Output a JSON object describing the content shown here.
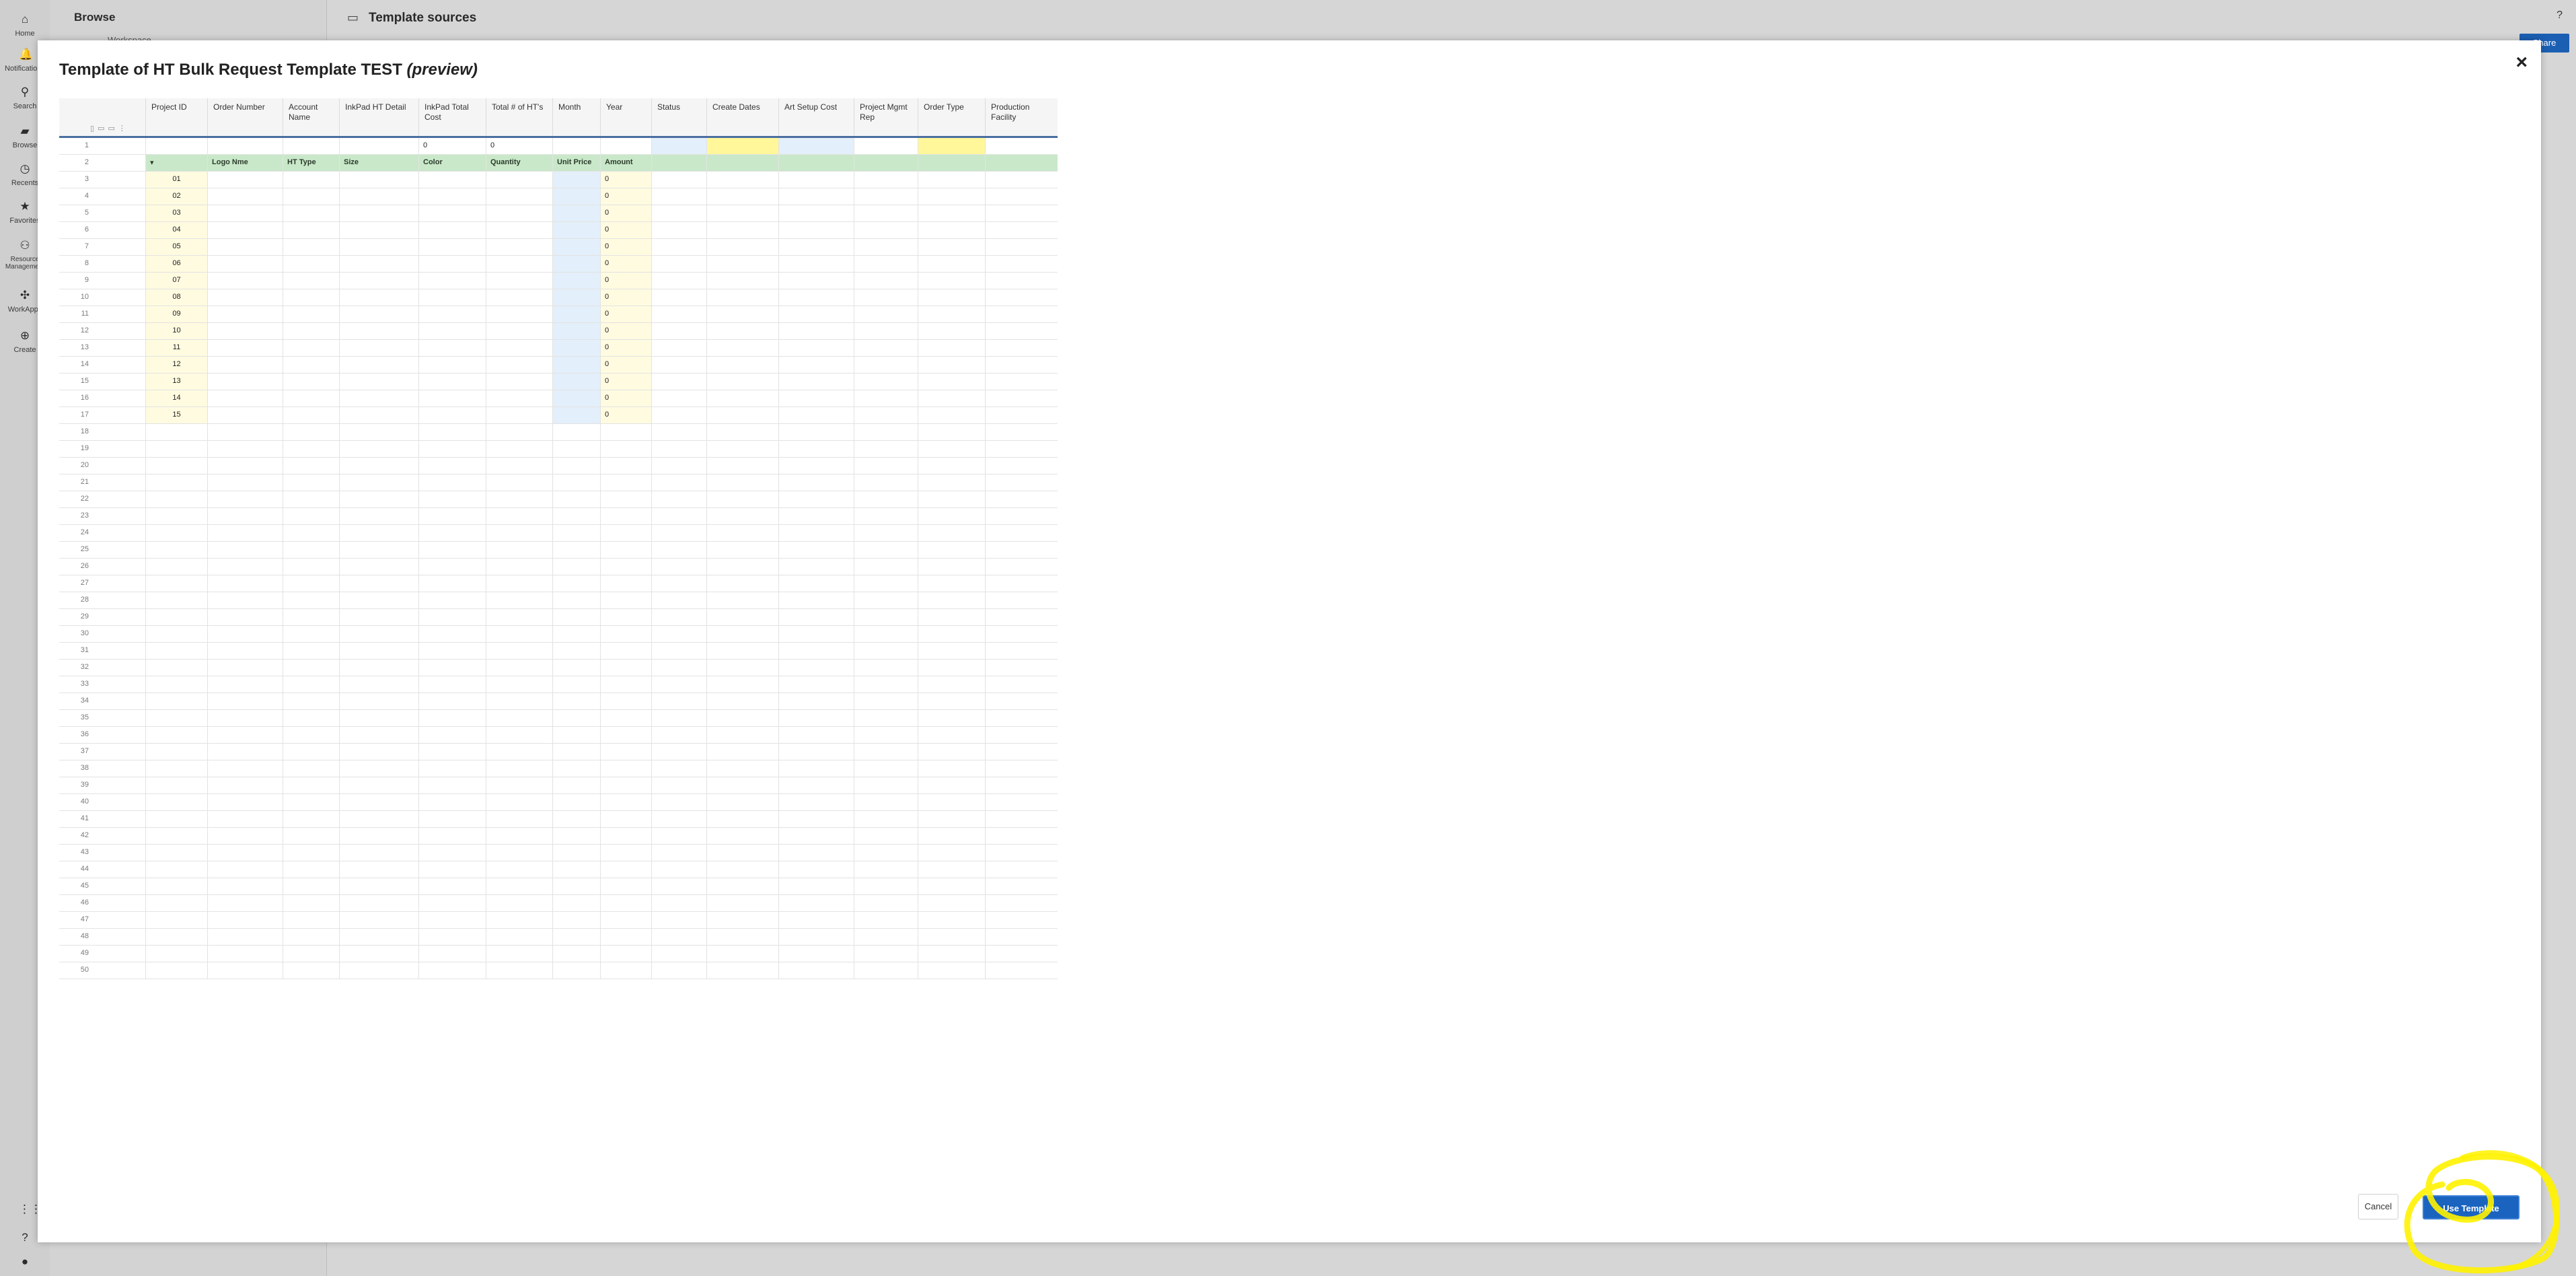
{
  "nav": {
    "items": [
      {
        "label": "Home",
        "icon": "home-icon"
      },
      {
        "label": "Notifications",
        "icon": "bell-icon"
      },
      {
        "label": "Search",
        "icon": "search-icon"
      },
      {
        "label": "Browse",
        "icon": "folder-icon"
      },
      {
        "label": "Recents",
        "icon": "clock-icon"
      },
      {
        "label": "Favorites",
        "icon": "star-icon"
      },
      {
        "label": "Resource Management",
        "icon": "people-icon"
      },
      {
        "label": "WorkApps",
        "icon": "workapps-icon"
      },
      {
        "label": "Create",
        "icon": "plus-icon"
      }
    ]
  },
  "browse": {
    "title": "Browse",
    "sub": "Workspace"
  },
  "main": {
    "folder_title": "Template sources",
    "help": "?",
    "share": "Share"
  },
  "modal": {
    "title": "Template of HT Bulk Request Template TEST",
    "preview": "(preview)",
    "close": "×",
    "cancel": "Cancel",
    "use_template": "Use Template"
  },
  "sheet": {
    "columns": [
      "Project ID",
      "Order Number",
      "Account Name",
      "InkPad HT Detail",
      "InkPad Total Cost",
      "Total # of HT's",
      "Month",
      "Year",
      "Status",
      "Create Dates",
      "Art Setup Cost",
      "Project Mgmt Rep",
      "Order Type",
      "Production Facility"
    ],
    "row1": {
      "total_cost": "0",
      "total_hts": "0"
    },
    "row2": {
      "project_id": "▾",
      "order_number": "Logo Nme",
      "account_name": "HT Type",
      "inkpad_detail": "Size",
      "total_cost": "Color",
      "total_hts": "Quantity",
      "month": "Unit Price",
      "year": "Amount"
    },
    "item_ids": [
      "01",
      "02",
      "03",
      "04",
      "05",
      "06",
      "07",
      "08",
      "09",
      "10",
      "11",
      "12",
      "13",
      "14",
      "15"
    ],
    "item_amount": "0",
    "row_count": 50
  }
}
